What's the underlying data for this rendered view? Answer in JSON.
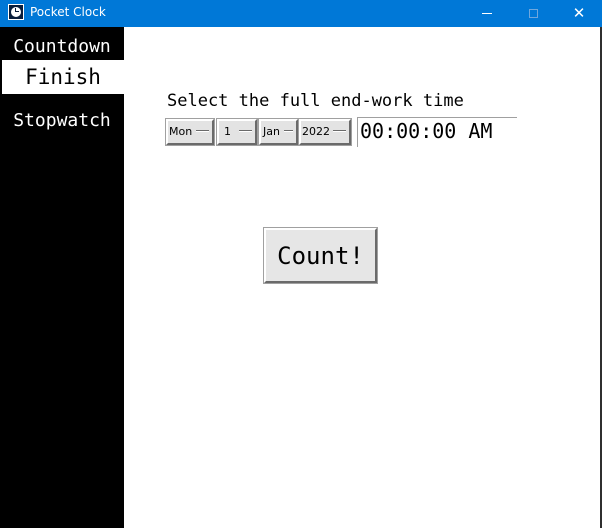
{
  "window": {
    "title": "Pocket Clock",
    "icon": "clock-icon",
    "controls": [
      "minimize-icon",
      "maximize-icon",
      "close-icon"
    ],
    "close_glyph": "✕",
    "accent_color": "#0078d7"
  },
  "sidebar": {
    "background": "#000000",
    "items": [
      {
        "label": "Countdown",
        "selected": false
      },
      {
        "label": "Finish",
        "selected": true
      },
      {
        "label": "Stopwatch",
        "selected": false
      }
    ]
  },
  "main": {
    "prompt": "Select the full end-work time",
    "date": {
      "weekday": "Mon",
      "day": "1",
      "month": "Jan",
      "year": "2022"
    },
    "time": "00:00:00 AM",
    "count_button_label": "Count!"
  }
}
